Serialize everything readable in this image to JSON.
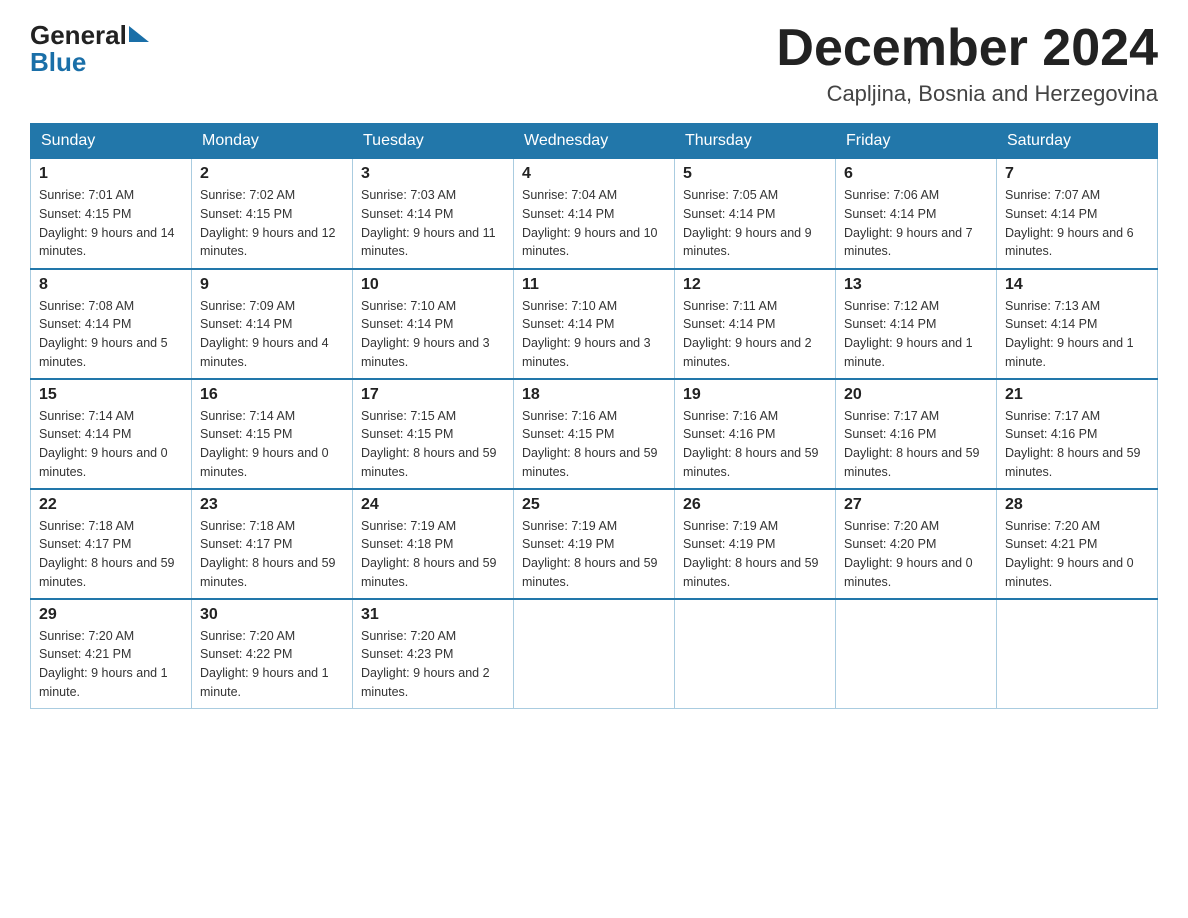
{
  "header": {
    "month_year": "December 2024",
    "location": "Capljina, Bosnia and Herzegovina"
  },
  "logo": {
    "part1": "General",
    "part2": "Blue"
  },
  "days_of_week": [
    "Sunday",
    "Monday",
    "Tuesday",
    "Wednesday",
    "Thursday",
    "Friday",
    "Saturday"
  ],
  "weeks": [
    [
      {
        "day": "1",
        "sunrise": "7:01 AM",
        "sunset": "4:15 PM",
        "daylight": "9 hours and 14 minutes."
      },
      {
        "day": "2",
        "sunrise": "7:02 AM",
        "sunset": "4:15 PM",
        "daylight": "9 hours and 12 minutes."
      },
      {
        "day": "3",
        "sunrise": "7:03 AM",
        "sunset": "4:14 PM",
        "daylight": "9 hours and 11 minutes."
      },
      {
        "day": "4",
        "sunrise": "7:04 AM",
        "sunset": "4:14 PM",
        "daylight": "9 hours and 10 minutes."
      },
      {
        "day": "5",
        "sunrise": "7:05 AM",
        "sunset": "4:14 PM",
        "daylight": "9 hours and 9 minutes."
      },
      {
        "day": "6",
        "sunrise": "7:06 AM",
        "sunset": "4:14 PM",
        "daylight": "9 hours and 7 minutes."
      },
      {
        "day": "7",
        "sunrise": "7:07 AM",
        "sunset": "4:14 PM",
        "daylight": "9 hours and 6 minutes."
      }
    ],
    [
      {
        "day": "8",
        "sunrise": "7:08 AM",
        "sunset": "4:14 PM",
        "daylight": "9 hours and 5 minutes."
      },
      {
        "day": "9",
        "sunrise": "7:09 AM",
        "sunset": "4:14 PM",
        "daylight": "9 hours and 4 minutes."
      },
      {
        "day": "10",
        "sunrise": "7:10 AM",
        "sunset": "4:14 PM",
        "daylight": "9 hours and 3 minutes."
      },
      {
        "day": "11",
        "sunrise": "7:10 AM",
        "sunset": "4:14 PM",
        "daylight": "9 hours and 3 minutes."
      },
      {
        "day": "12",
        "sunrise": "7:11 AM",
        "sunset": "4:14 PM",
        "daylight": "9 hours and 2 minutes."
      },
      {
        "day": "13",
        "sunrise": "7:12 AM",
        "sunset": "4:14 PM",
        "daylight": "9 hours and 1 minute."
      },
      {
        "day": "14",
        "sunrise": "7:13 AM",
        "sunset": "4:14 PM",
        "daylight": "9 hours and 1 minute."
      }
    ],
    [
      {
        "day": "15",
        "sunrise": "7:14 AM",
        "sunset": "4:14 PM",
        "daylight": "9 hours and 0 minutes."
      },
      {
        "day": "16",
        "sunrise": "7:14 AM",
        "sunset": "4:15 PM",
        "daylight": "9 hours and 0 minutes."
      },
      {
        "day": "17",
        "sunrise": "7:15 AM",
        "sunset": "4:15 PM",
        "daylight": "8 hours and 59 minutes."
      },
      {
        "day": "18",
        "sunrise": "7:16 AM",
        "sunset": "4:15 PM",
        "daylight": "8 hours and 59 minutes."
      },
      {
        "day": "19",
        "sunrise": "7:16 AM",
        "sunset": "4:16 PM",
        "daylight": "8 hours and 59 minutes."
      },
      {
        "day": "20",
        "sunrise": "7:17 AM",
        "sunset": "4:16 PM",
        "daylight": "8 hours and 59 minutes."
      },
      {
        "day": "21",
        "sunrise": "7:17 AM",
        "sunset": "4:16 PM",
        "daylight": "8 hours and 59 minutes."
      }
    ],
    [
      {
        "day": "22",
        "sunrise": "7:18 AM",
        "sunset": "4:17 PM",
        "daylight": "8 hours and 59 minutes."
      },
      {
        "day": "23",
        "sunrise": "7:18 AM",
        "sunset": "4:17 PM",
        "daylight": "8 hours and 59 minutes."
      },
      {
        "day": "24",
        "sunrise": "7:19 AM",
        "sunset": "4:18 PM",
        "daylight": "8 hours and 59 minutes."
      },
      {
        "day": "25",
        "sunrise": "7:19 AM",
        "sunset": "4:19 PM",
        "daylight": "8 hours and 59 minutes."
      },
      {
        "day": "26",
        "sunrise": "7:19 AM",
        "sunset": "4:19 PM",
        "daylight": "8 hours and 59 minutes."
      },
      {
        "day": "27",
        "sunrise": "7:20 AM",
        "sunset": "4:20 PM",
        "daylight": "9 hours and 0 minutes."
      },
      {
        "day": "28",
        "sunrise": "7:20 AM",
        "sunset": "4:21 PM",
        "daylight": "9 hours and 0 minutes."
      }
    ],
    [
      {
        "day": "29",
        "sunrise": "7:20 AM",
        "sunset": "4:21 PM",
        "daylight": "9 hours and 1 minute."
      },
      {
        "day": "30",
        "sunrise": "7:20 AM",
        "sunset": "4:22 PM",
        "daylight": "9 hours and 1 minute."
      },
      {
        "day": "31",
        "sunrise": "7:20 AM",
        "sunset": "4:23 PM",
        "daylight": "9 hours and 2 minutes."
      },
      null,
      null,
      null,
      null
    ]
  ],
  "labels": {
    "sunrise": "Sunrise:",
    "sunset": "Sunset:",
    "daylight": "Daylight:"
  }
}
